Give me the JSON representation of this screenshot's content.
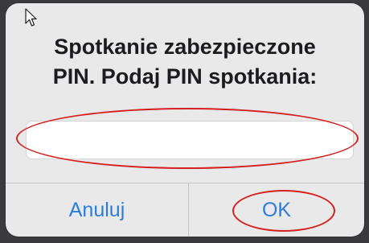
{
  "dialog": {
    "message_line1": "Spotkanie zabezpieczone",
    "message_line2": "PIN. Podaj PIN spotkania:",
    "pin_value": "",
    "cancel_label": "Anuluj",
    "ok_label": "OK"
  },
  "icons": {
    "cursor": "mouse-pointer-icon"
  },
  "colors": {
    "dialog_background": "#e9e9ea",
    "button_text": "#2f7bd9",
    "annotation": "#d42020"
  }
}
